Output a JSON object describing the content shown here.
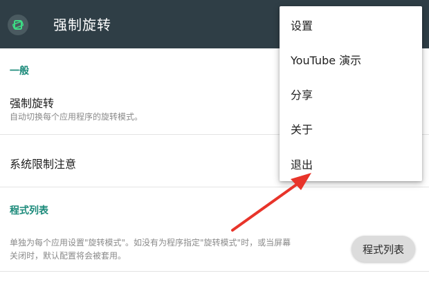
{
  "app_bar": {
    "title": "强制旋转",
    "icon": "rotate-screen-icon",
    "background": "#2f3e46"
  },
  "settings": {
    "section_general": "一般",
    "force_rotate": {
      "title": "强制旋转",
      "subtitle": "自动切换每个应用程序的旋转模式。"
    },
    "system_limit_notice": {
      "title": "系统限制注意"
    },
    "section_app_list": "程式列表",
    "app_list_desc_line1": "单独为每个应用设置\"旋转模式\"。如没有为程序指定\"旋转模式\"时，或当屏幕",
    "app_list_desc_line2": "关闭时，默认配置将会被套用。",
    "app_list_button": "程式列表"
  },
  "overflow_menu": {
    "items": [
      "设置",
      "YouTube 演示",
      "分享",
      "关于",
      "退出"
    ]
  },
  "colors": {
    "accent": "#1b8a7a",
    "annotation_arrow": "#e8342a"
  }
}
